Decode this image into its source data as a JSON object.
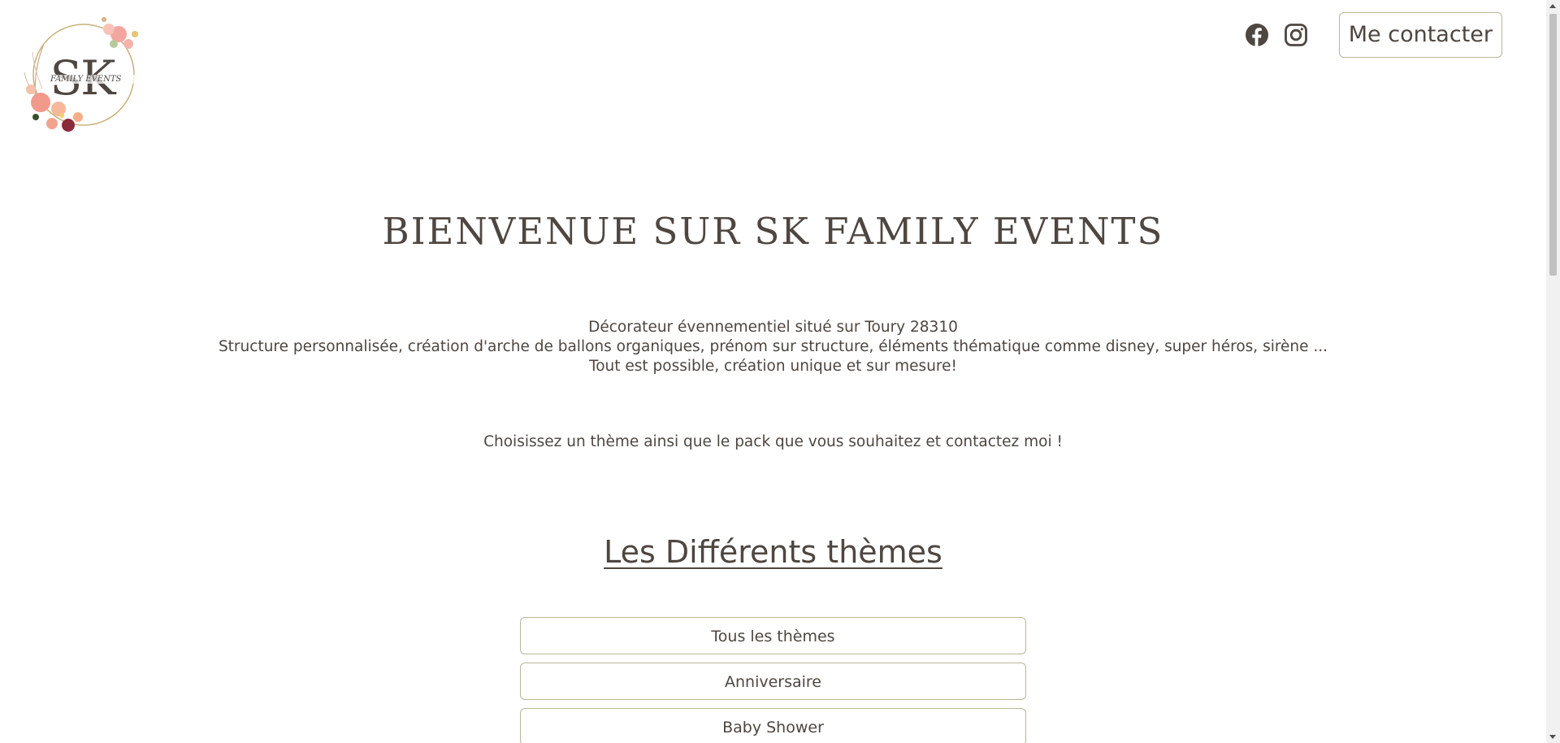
{
  "header": {
    "logo": {
      "monogram": "SK",
      "subtitle": "FAMILY EVENTS"
    },
    "social": [
      {
        "icon": "facebook-icon"
      },
      {
        "icon": "instagram-icon"
      }
    ],
    "contact_label": "Me contacter"
  },
  "main": {
    "title": "BIENVENUE SUR SK FAMILY EVENTS",
    "intro_lines": [
      "Décorateur évennementiel situé sur Toury 28310",
      "Structure personnalisée, création d'arche de ballons organiques, prénom sur structure, éléments thématique comme disney, super héros, sirène ...",
      "Tout est possible, création unique et sur mesure!"
    ],
    "cta": "Choisissez un thème ainsi que le pack que vous souhaitez et contactez moi !",
    "themes_title": "Les Différents thèmes",
    "themes": [
      {
        "label": "Tous les thèmes"
      },
      {
        "label": "Anniversaire"
      },
      {
        "label": "Baby Shower"
      }
    ]
  },
  "colors": {
    "text": "#4e4640",
    "border": "#b9b79a",
    "logo_ring": "#c9b27a"
  }
}
